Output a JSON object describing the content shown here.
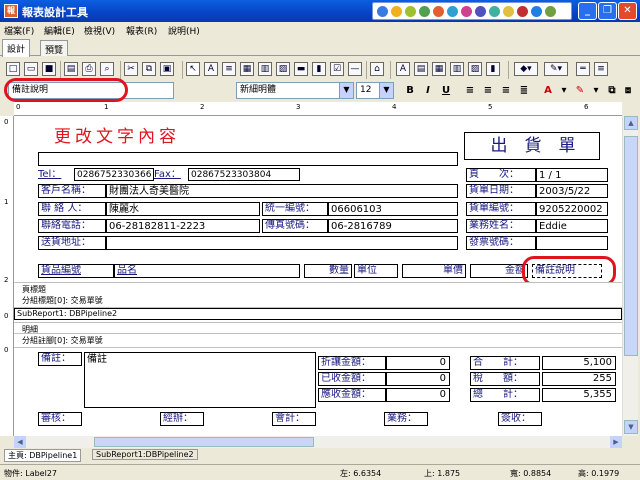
{
  "app": {
    "title": "報表設計工具"
  },
  "menu": [
    "檔案(F)",
    "編輯(E)",
    "檢視(V)",
    "報表(R)",
    "說明(H)"
  ],
  "tabs": [
    "設計",
    "預覽"
  ],
  "format": {
    "component": "備註說明",
    "font": "新細明體",
    "size": "12",
    "bold": "B",
    "italic": "I",
    "underline": "U"
  },
  "report": {
    "heading": "更改文字內容",
    "doc_title": "出　貨　單",
    "tel_label": "Tel：",
    "tel_value": "0286752330366",
    "fax_label": "Fax：",
    "fax_value": "02867523303804",
    "customer_label": "客戶名稱：",
    "customer_value": "財團法人奇美醫院",
    "contact_label": "聯 絡 人：",
    "contact_value": "陳麗水",
    "taxid_label": "統一編號：",
    "taxid_value": "06606103",
    "phone_label": "聯絡電話：",
    "phone_value": "06-28182811-2223",
    "faxno_label": "傳真號碼：",
    "faxno_value": "06-2816789",
    "address_label": "送貨地址：",
    "page_label": "頁　　次：",
    "page_value": "1 / 1",
    "date_label": "貨單日期：",
    "date_value": "2003/5/22",
    "orderno_label": "貨單編號：",
    "orderno_value": "9205220002",
    "sales_label": "業務姓名：",
    "sales_value": "Eddie",
    "invoice_label": "發票號碼：",
    "cols": {
      "code": "貨品編號",
      "name": "品名",
      "qty": "數量",
      "unit": "單位",
      "price": "單價",
      "amount": "金額",
      "remark": "備註說明"
    },
    "band_page_header": "頁標題",
    "band_group_header": "分組標題[0]: 交易單號",
    "subreport": "SubReport1: DBPipeline2",
    "band_detail": "明細",
    "band_group_footer": "分組註腳[0]: 交易單號",
    "note_label": "備註：",
    "note_value": "備註",
    "discount_label": "折讓金額：",
    "discount_value": "0",
    "received_label": "已收金額：",
    "received_value": "0",
    "receivable_label": "應收金額：",
    "receivable_value": "0",
    "subtotal_label": "合　　計：",
    "subtotal_value": "5,100",
    "tax_label": "稅　　額：",
    "tax_value": "255",
    "total_label": "總　　計：",
    "total_value": "5,355",
    "sign": [
      "審核：",
      "經辦：",
      "會計：",
      "業務：",
      "簽收："
    ]
  },
  "page_tabs": [
    "主頁: DBPipeline1",
    "SubReport1:DBPipeline2"
  ],
  "status": {
    "object": "物件: Label27",
    "left": "左: 6.6354",
    "top": "上: 1.875",
    "width": "寬: 0.8854",
    "height": "高: 0.1979"
  },
  "colors": {
    "title_bar": "#0843c6",
    "highlight": "#e0141e",
    "heading": "#e0141e",
    "label": "#1a1a80"
  }
}
